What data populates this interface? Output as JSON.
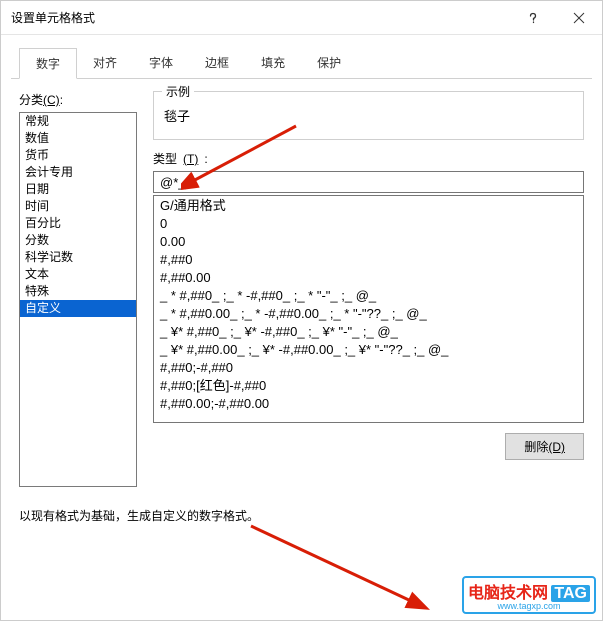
{
  "title": "设置单元格格式",
  "tabs": [
    "数字",
    "对齐",
    "字体",
    "边框",
    "填充",
    "保护"
  ],
  "active_tab_index": 0,
  "category": {
    "label_prefix": "分类",
    "label_hotkey": "(C)",
    "items": [
      "常规",
      "数值",
      "货币",
      "会计专用",
      "日期",
      "时间",
      "百分比",
      "分数",
      "科学记数",
      "文本",
      "特殊",
      "自定义"
    ],
    "selected_index": 11
  },
  "example": {
    "label": "示例",
    "value": "毯子"
  },
  "type": {
    "label_prefix": "类型",
    "label_hotkey": "(T)",
    "value": "@*_"
  },
  "format_list": [
    "G/通用格式",
    "0",
    "0.00",
    "#,##0",
    "#,##0.00",
    "_ * #,##0_ ;_ * -#,##0_ ;_ * \"-\"_ ;_ @_ ",
    "_ * #,##0.00_ ;_ * -#,##0.00_ ;_ * \"-\"??_ ;_ @_ ",
    "_ ¥* #,##0_ ;_ ¥* -#,##0_ ;_ ¥* \"-\"_ ;_ @_ ",
    "_ ¥* #,##0.00_ ;_ ¥* -#,##0.00_ ;_ ¥* \"-\"??_ ;_ @_ ",
    "#,##0;-#,##0",
    "#,##0;[红色]-#,##0",
    "#,##0.00;-#,##0.00"
  ],
  "delete_btn": {
    "text_prefix": "删除",
    "hotkey": "(D)"
  },
  "description": "以现有格式为基础，生成自定义的数字格式。",
  "watermark": {
    "line1a": "电脑技术网",
    "line1b": "TAG",
    "line2": "www.tagxp.com"
  }
}
